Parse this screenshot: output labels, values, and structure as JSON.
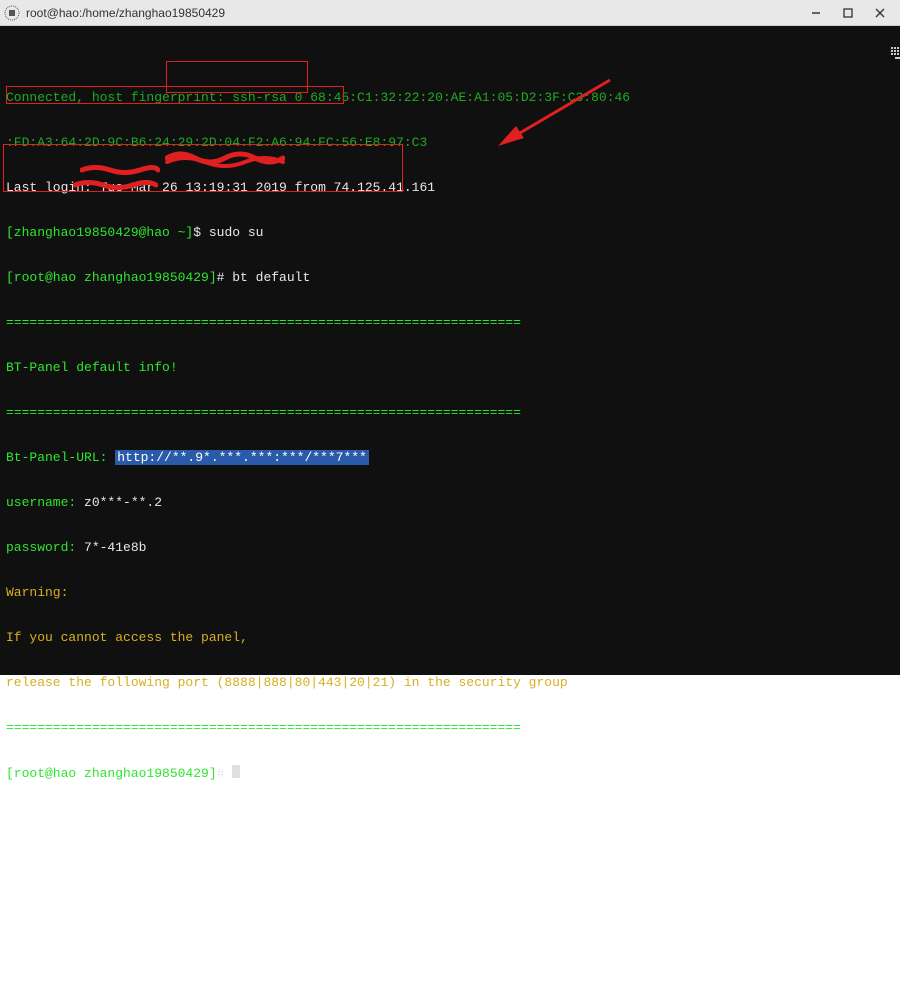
{
  "titlebar": {
    "title": "root@hao:/home/zhanghao19850429"
  },
  "term": {
    "line1": "Connected, host fingerprint: ssh-rsa 0 68:45:C1:32:22:20:AE:A1:05:D2:3F:C3:80:46",
    "line2": ":FD:A3:64:2D:9C:B6:24:29:2D:04:F2:A6:94:FC:56:E8:97:C3",
    "line3_a": "Last login: Tue Mar 26 ",
    "line3_b": "13:19:31 2019",
    "line3_c": " from 74.125.41.161",
    "line4_a": "[zhanghao19850429@hao ~]",
    "line4_b": "$ sudo su",
    "line5_a": "[root@hao zhanghao19850429]",
    "line5_b": "# bt default",
    "sep": "==================================================================",
    "panel_title": "BT-Panel default info!",
    "url_label": "Bt-Panel-URL: ",
    "url_prefix": "http://",
    "url_mask": "**.9*.***.***:***/***7***",
    "user_label": "username: ",
    "user_val": "z0***-**.2",
    "pass_label": "password: ",
    "pass_val": "7*-41e8b",
    "warn1": "Warning:",
    "warn2": "If you cannot access the panel,",
    "warn3": "release the following port (8888|888|80|443|20|21) in the security group",
    "prompt_final_a": "[root@hao zhanghao19850429]",
    "prompt_final_b": "# "
  }
}
